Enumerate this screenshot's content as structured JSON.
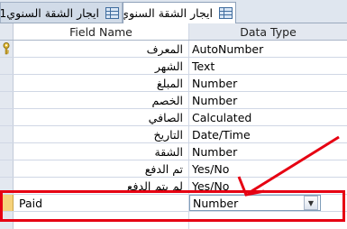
{
  "tabs": [
    {
      "label": "ايجار الشقة السنوي1",
      "active": false,
      "icon": "table-icon"
    },
    {
      "label": "ايجار الشقة السنوي",
      "active": true,
      "icon": "table-icon"
    }
  ],
  "columns": {
    "field_name": "Field Name",
    "data_type": "Data Type"
  },
  "rows": [
    {
      "field": "المعرف",
      "type": "AutoNumber",
      "primary_key": true
    },
    {
      "field": "الشهر",
      "type": "Text"
    },
    {
      "field": "المبلغ",
      "type": "Number"
    },
    {
      "field": "الخصم",
      "type": "Number"
    },
    {
      "field": "الصافي",
      "type": "Calculated"
    },
    {
      "field": "التاريخ",
      "type": "Date/Time"
    },
    {
      "field": "الشقة",
      "type": "Number"
    },
    {
      "field": "تم الدفع",
      "type": "Yes/No"
    },
    {
      "field": "لم يتم الدفع",
      "type": "Yes/No"
    },
    {
      "field": "Paid",
      "type": "Number",
      "selected": true
    }
  ],
  "colors": {
    "annotation": "#e60012",
    "selected_row_marker": "#f6d27a"
  }
}
